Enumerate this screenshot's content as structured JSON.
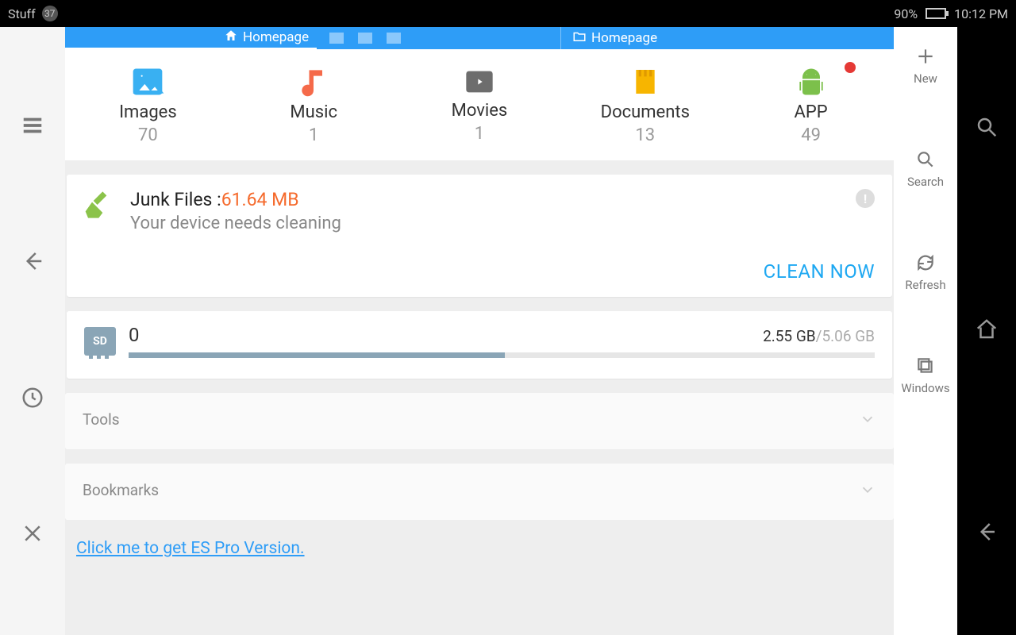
{
  "statusbar": {
    "folder_label": "Stuff",
    "notif_count": "37",
    "battery_pct": "90%",
    "clock": "10:12 PM"
  },
  "tabs": {
    "tab1_label": "Homepage",
    "tab2_label": "Homepage"
  },
  "categories": [
    {
      "label": "Images",
      "count": "70",
      "color": "#39b0f2"
    },
    {
      "label": "Music",
      "count": "1",
      "color": "#f56a4a"
    },
    {
      "label": "Movies",
      "count": "1",
      "color": "#6d6d6d"
    },
    {
      "label": "Documents",
      "count": "13",
      "color": "#f7b500"
    },
    {
      "label": "APP",
      "count": "49",
      "color": "#7cc04b",
      "badge": true
    }
  ],
  "junk": {
    "title_prefix": "Junk Files :",
    "title_size": "61.64 MB",
    "subtitle": "Your device needs cleaning",
    "action": "CLEAN NOW"
  },
  "storage": {
    "label": "0",
    "used": "2.55 GB",
    "sep": "/",
    "total": "5.06 GB",
    "used_pct": 50.4
  },
  "sections": {
    "tools": "Tools",
    "bookmarks": "Bookmarks"
  },
  "pro_link": "Click me to get ES Pro Version.",
  "right_rail": {
    "new": "New",
    "search": "Search",
    "refresh": "Refresh",
    "windows": "Windows"
  }
}
